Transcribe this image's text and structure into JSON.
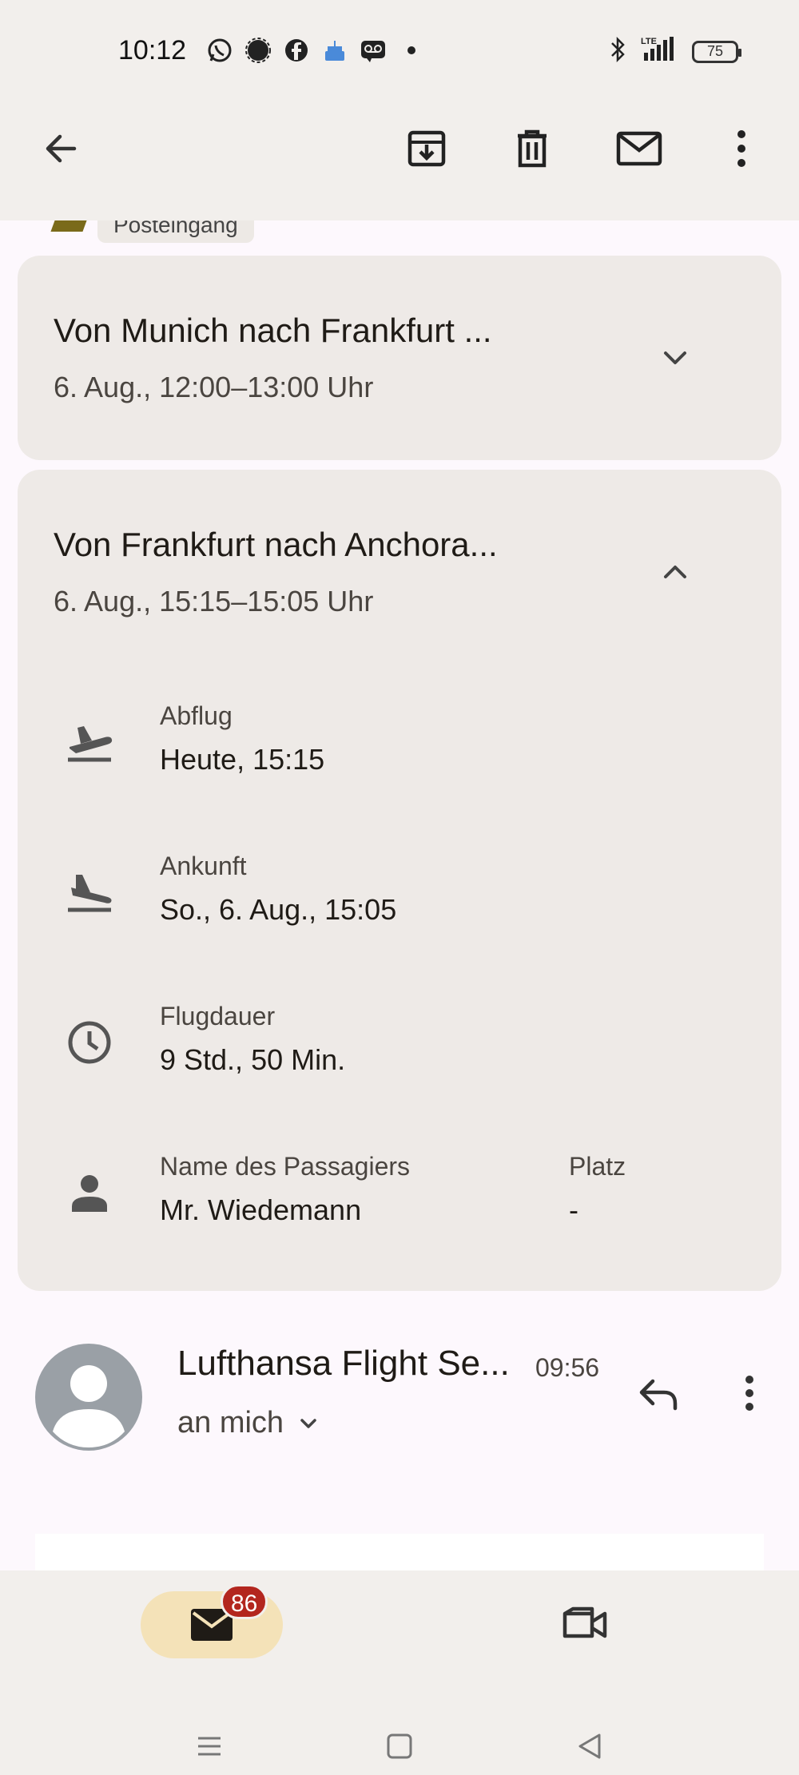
{
  "status_bar": {
    "time": "10:12",
    "notification_icons": [
      "whatsapp-icon",
      "signal-icon",
      "facebook-icon",
      "cake-icon",
      "voicemail-icon",
      "dot-icon"
    ],
    "network": "LTE",
    "battery": "75"
  },
  "toolbar": {
    "back": "back-arrow-icon",
    "archive": "archive-icon",
    "delete": "trash-icon",
    "mark_unread": "mail-icon",
    "more": "more-vert-icon"
  },
  "label_chip": "Posteingang",
  "flights": [
    {
      "title": "Von Munich nach Frankfurt ...",
      "time": "6. Aug., 12:00–13:00 Uhr",
      "expanded": false
    },
    {
      "title": "Von Frankfurt nach Anchora...",
      "time": "6. Aug., 15:15–15:05 Uhr",
      "expanded": true,
      "details": {
        "departure_label": "Abflug",
        "departure_value": "Heute, 15:15",
        "arrival_label": "Ankunft",
        "arrival_value": "So., 6. Aug., 15:05",
        "duration_label": "Flugdauer",
        "duration_value": "9 Std., 50 Min.",
        "passenger_label": "Name des Passagiers",
        "passenger_value": "Mr. Wiedemann",
        "seat_label": "Platz",
        "seat_value": "-"
      }
    }
  ],
  "message": {
    "sender": "Lufthansa Flight Se...",
    "time": "09:56",
    "recipient": "an mich"
  },
  "bottom_nav": {
    "mail_badge": "86"
  },
  "colors": {
    "card_bg": "#eeeae7",
    "bar_bg": "#f2efec",
    "pill_active": "#f4e2b8",
    "badge": "#b3261e",
    "avatar": "#9aa0a6"
  }
}
